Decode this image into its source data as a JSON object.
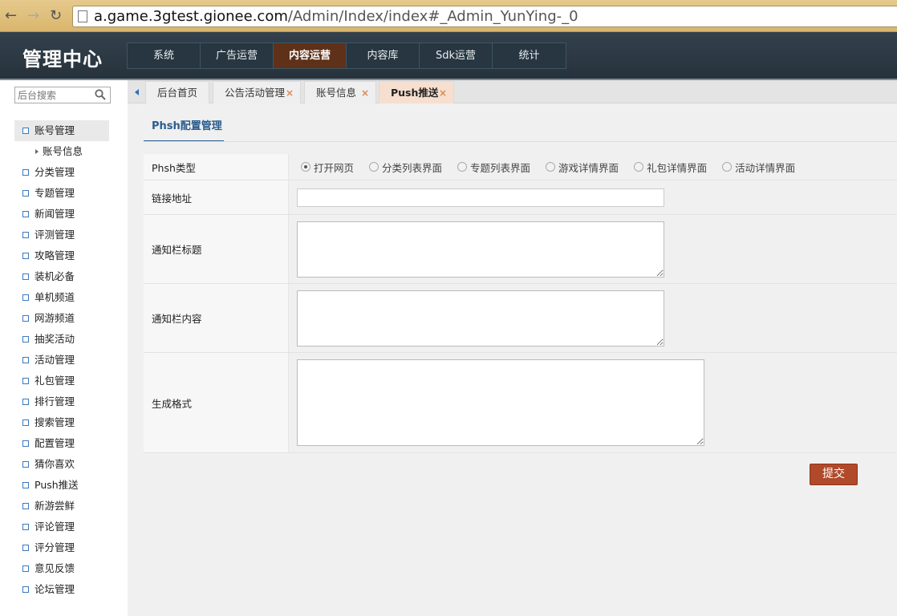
{
  "browser": {
    "url_host": "a.game.3gtest.gionee.com",
    "url_path": "/Admin/Index/index#_Admin_YunYing-_0"
  },
  "header": {
    "logo": "管理中心",
    "nav": [
      "系统",
      "广告运营",
      "内容运营",
      "内容库",
      "Sdk运营",
      "统计"
    ],
    "active_nav": "内容运营"
  },
  "sidebar": {
    "search_placeholder": "后台搜索",
    "items": [
      "账号管理",
      "分类管理",
      "专题管理",
      "新闻管理",
      "评测管理",
      "攻略管理",
      "装机必备",
      "单机频道",
      "网游频道",
      "抽奖活动",
      "活动管理",
      "礼包管理",
      "排行管理",
      "搜索管理",
      "配置管理",
      "猜你喜欢",
      "Push推送",
      "新游尝鲜",
      "评论管理",
      "评分管理",
      "意见反馈",
      "论坛管理"
    ],
    "subitem": "账号信息"
  },
  "tabs": [
    "后台首页",
    "公告活动管理",
    "账号信息",
    "Push推送"
  ],
  "tab_close": "×",
  "section_title": "Phsh配置管理",
  "form": {
    "type_label": "Phsh类型",
    "type_options": [
      "打开网页",
      "分类列表界面",
      "专题列表界面",
      "游戏详情界面",
      "礼包详情界面",
      "活动详情界面"
    ],
    "selected_option": "打开网页",
    "link_label": "链接地址",
    "link_value": "",
    "title_label": "通知栏标题",
    "content_label": "通知栏内容",
    "format_label": "生成格式",
    "submit_label": "提交"
  }
}
